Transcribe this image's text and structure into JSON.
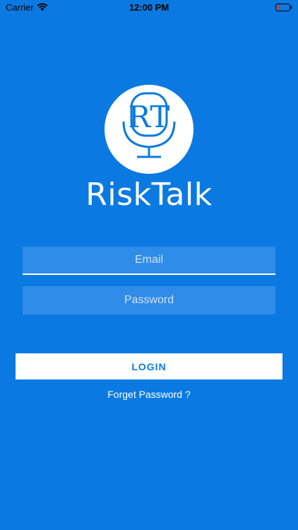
{
  "status_bar": {
    "carrier": "Carrier",
    "time": "12:00 PM"
  },
  "brand": {
    "monogram": "RT",
    "name": "RiskTalk"
  },
  "form": {
    "email_placeholder": "Email",
    "password_placeholder": "Password",
    "login_label": "LOGIN",
    "forgot_label": "Forget Password ?"
  },
  "colors": {
    "background": "#0a7ae2",
    "field_fill": "#2f8ce8",
    "button_bg": "#ffffff",
    "button_text": "#0a7ae2"
  },
  "icons": [
    "wifi-icon",
    "battery-icon",
    "microphone-icon"
  ]
}
